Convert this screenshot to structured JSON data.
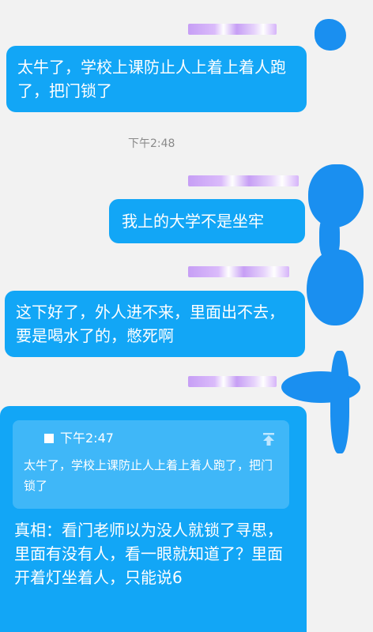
{
  "messages": {
    "msg1": {
      "text": "太牛了，学校上课防止人上着上着人跑了，把门锁了"
    },
    "timestamp1": "下午2:48",
    "msg2": {
      "text": "我上的大学不是坐牢"
    },
    "msg3": {
      "text": "这下好了，外人进不来，里面出不去，要是喝水了的，憋死啊"
    },
    "msg4": {
      "quote": {
        "time": "下午2:47",
        "text": "太牛了，学校上课防止人上着上着人跑了，把门锁了"
      },
      "text": "真相：看门老师以为没人就锁了寻思，里面有没有人，看一眼就知道了？里面开着灯坐着人，只能说6"
    }
  },
  "colors": {
    "bubble": "#12a6f6",
    "background": "#f2f2f2",
    "redaction": "#1a8ff0"
  },
  "icons": {
    "quote_jump": "arrow-up-to-line-icon"
  }
}
